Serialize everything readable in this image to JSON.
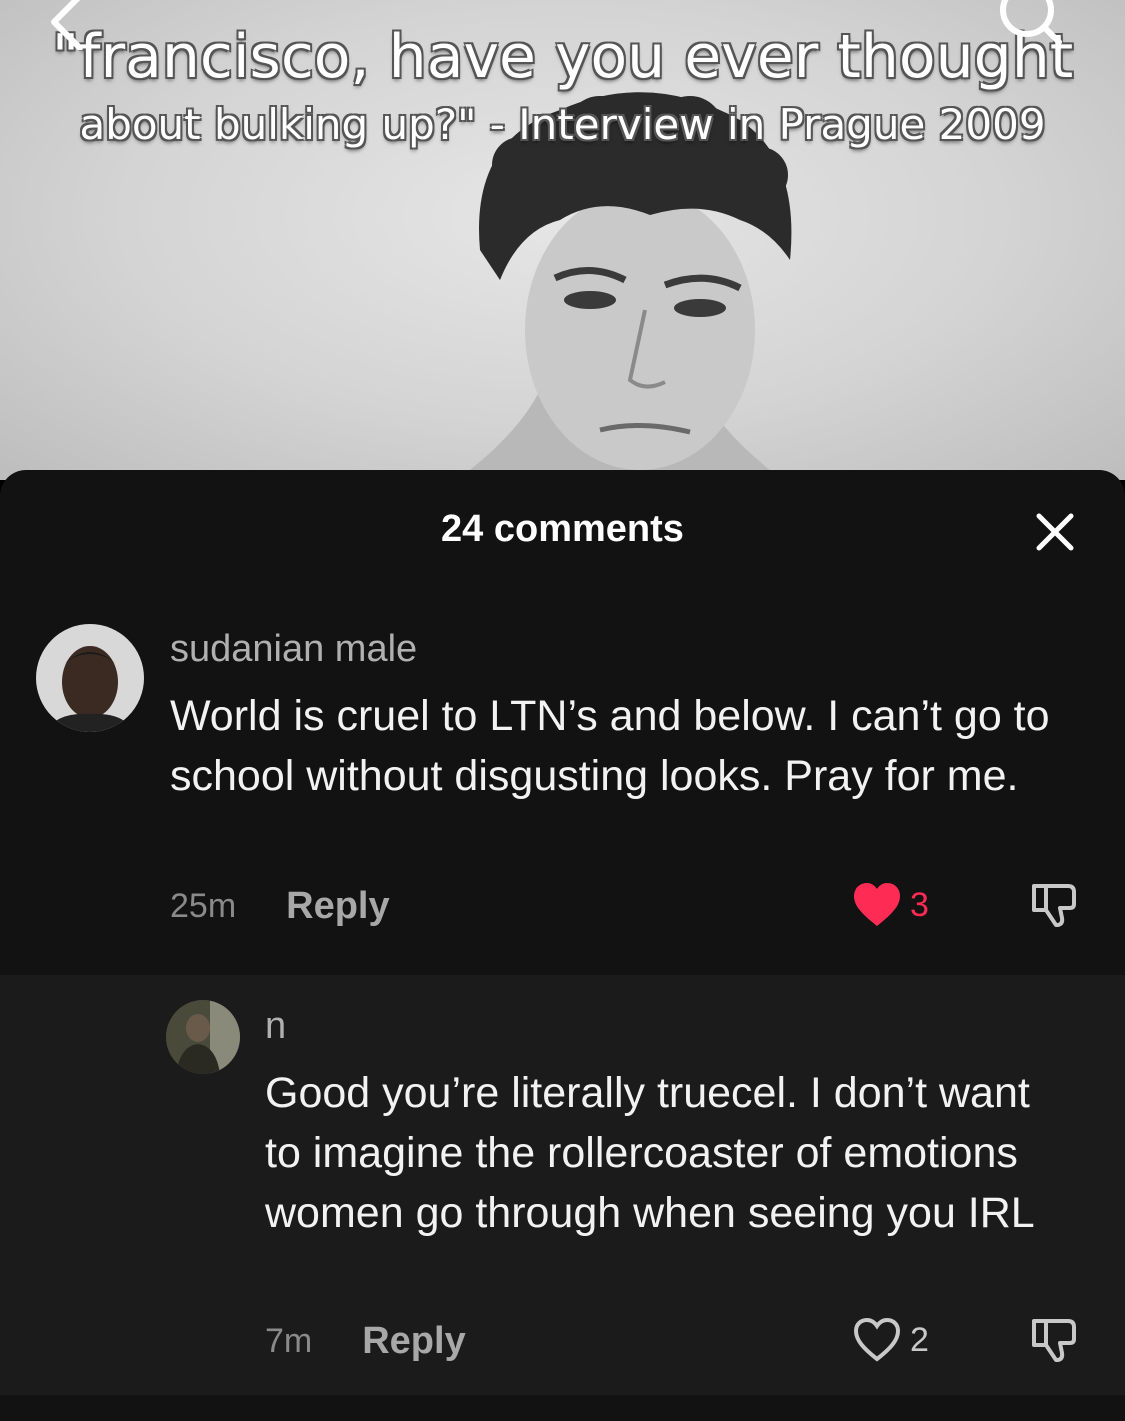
{
  "video": {
    "caption_line1": "\"francisco, have you ever thought",
    "caption_line2": "about bulking up?\" - Interview in Prague 2009",
    "back_icon": "chevron-left-icon",
    "search_icon": "search-icon"
  },
  "sheet": {
    "title": "24 comments",
    "close_icon": "close-icon"
  },
  "comments": [
    {
      "username": "sudanian male",
      "text": "World is cruel to LTN’s and below. I can’t go to school without disgusting looks. Pray for me.",
      "time": "25m",
      "reply_label": "Reply",
      "likes": "3",
      "liked": true
    },
    {
      "username": "n",
      "text": "Good you’re literally truecel. I don’t want to imagine the rollercoaster of emotions women go through when seeing you IRL",
      "time": "7m",
      "reply_label": "Reply",
      "likes": "2",
      "liked": false
    }
  ],
  "colors": {
    "sheet_bg": "#121212",
    "reply_bg": "#1b1b1b",
    "like_active": "#fe2c55"
  }
}
